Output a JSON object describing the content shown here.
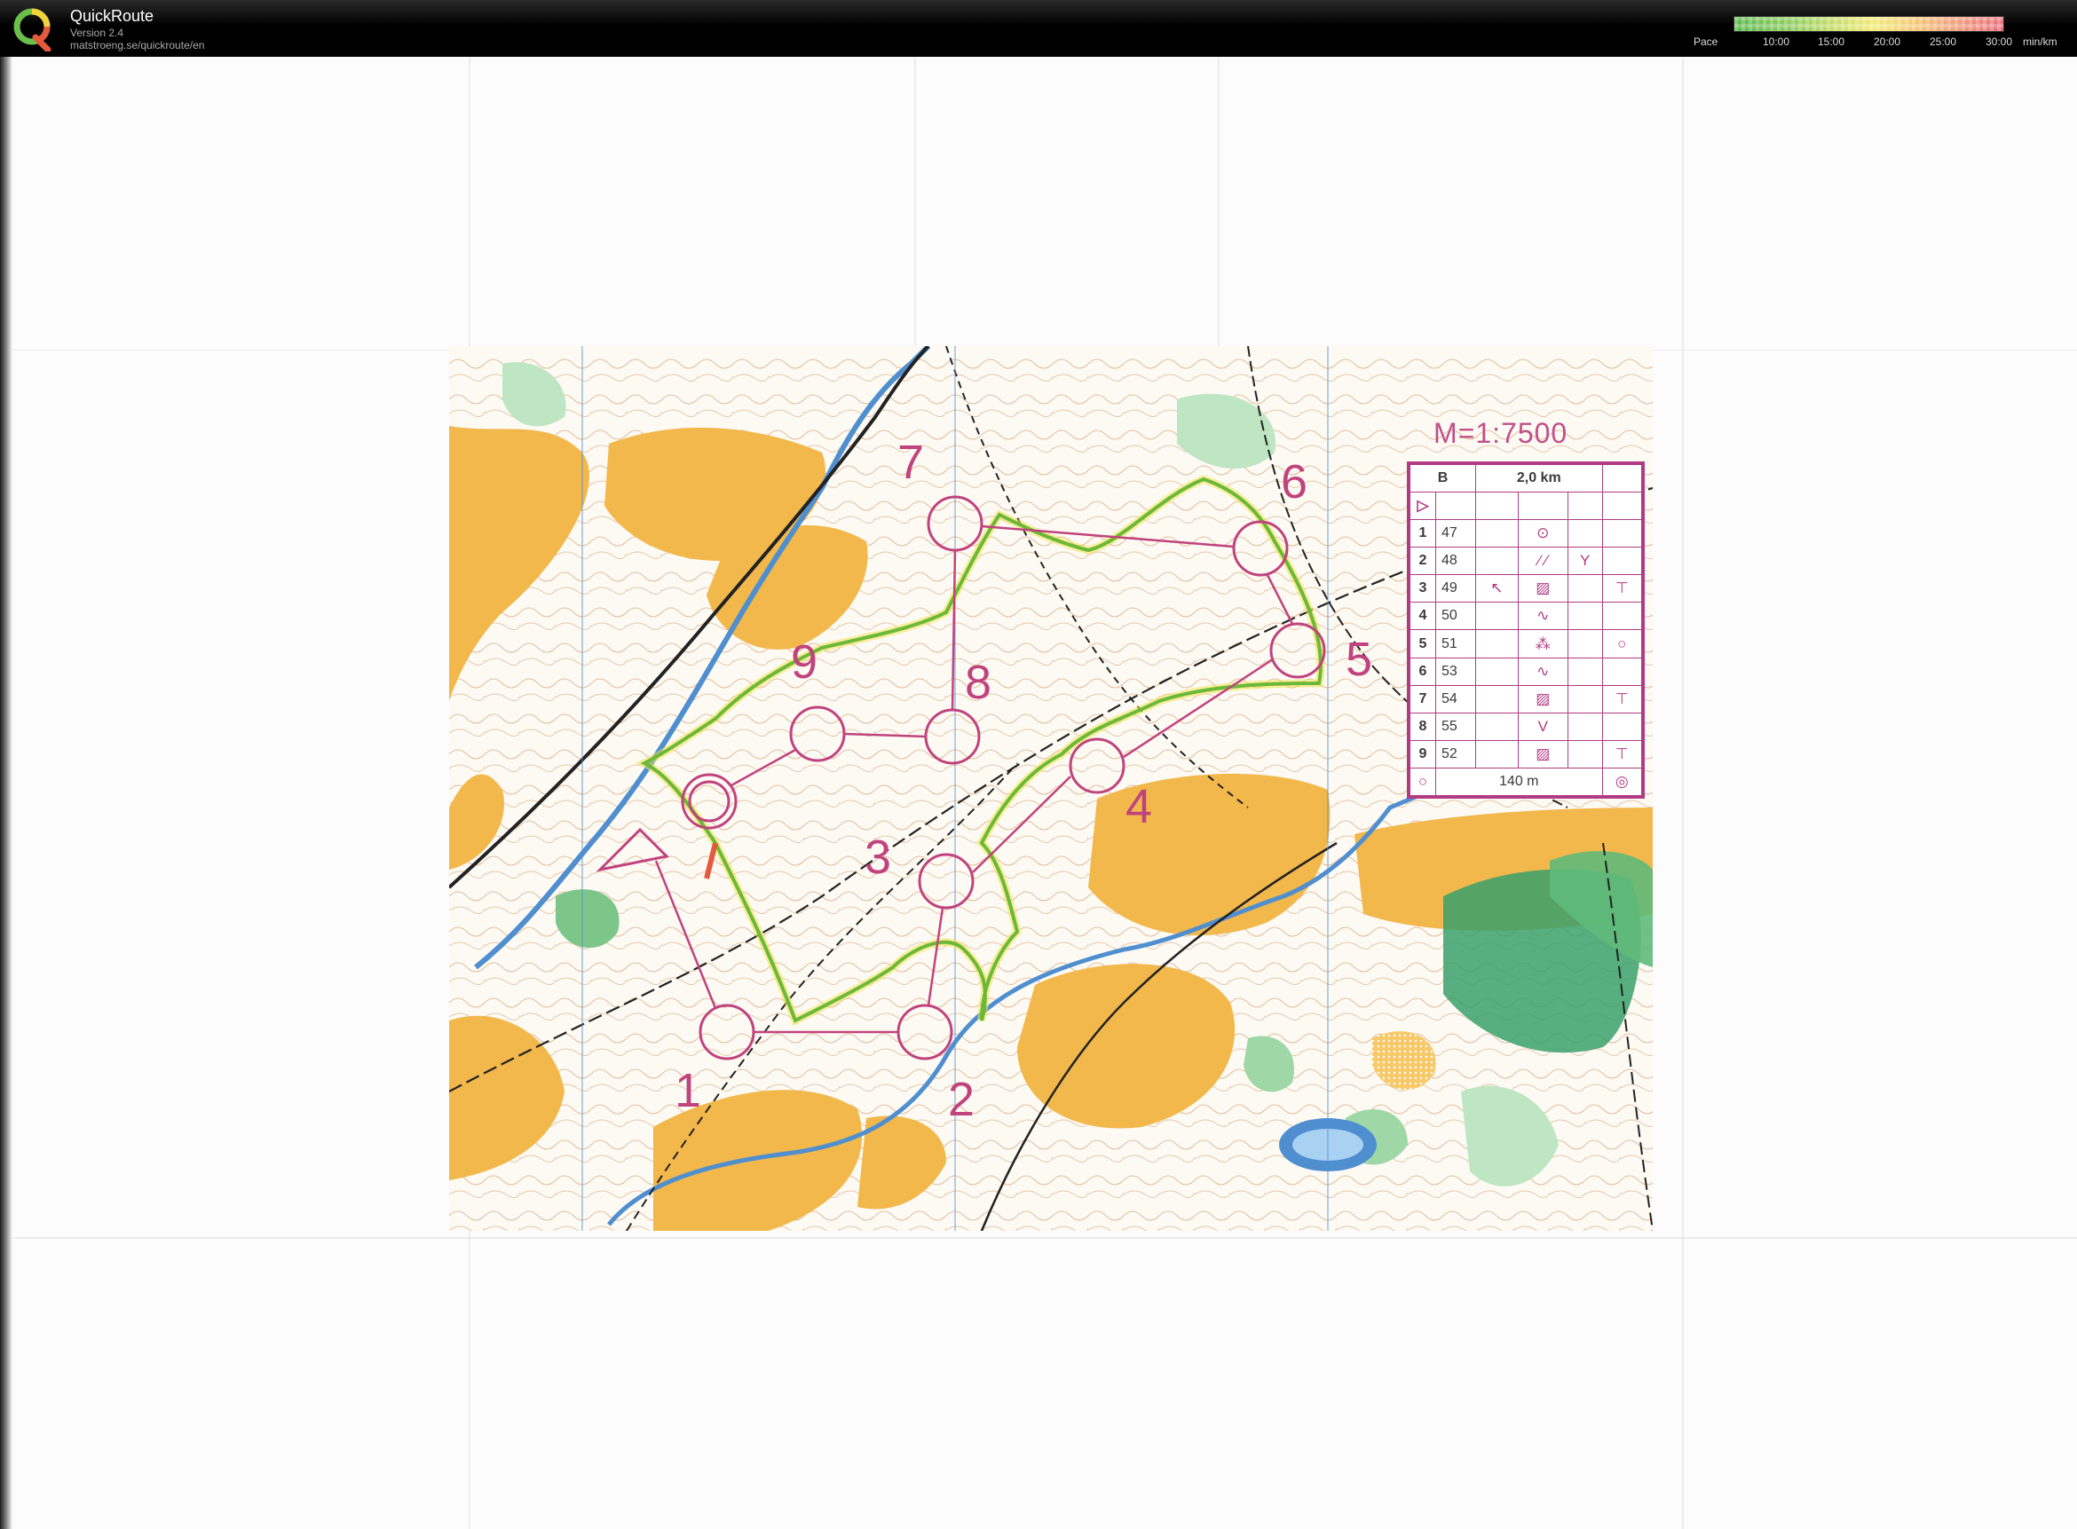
{
  "app": {
    "title": "QuickRoute",
    "version": "Version 2.4",
    "url": "matstroeng.se/quickroute/en"
  },
  "pace_legend": {
    "label": "Pace",
    "ticks": [
      "10:00",
      "15:00",
      "20:00",
      "25:00",
      "30:00"
    ],
    "unit": "min/km",
    "colors": [
      "#5fba52",
      "#c9de6b",
      "#f3eb78",
      "#f09a7e",
      "#e8707c"
    ]
  },
  "map": {
    "scale": "M=1:7500",
    "control_numbers": [
      "1",
      "2",
      "3",
      "4",
      "5",
      "6",
      "7",
      "8",
      "9"
    ],
    "colors": {
      "course": "#c0437e",
      "open_land": "#f2b84b",
      "forest_green": "#3aa06a",
      "water": "#4f8fd0",
      "route": "#9fcc3a"
    }
  },
  "description_sheet": {
    "class": "B",
    "length": "2,0 km",
    "controls": [
      {
        "num": "1",
        "code": "47",
        "s1": "",
        "s2": "⊙",
        "s3": "",
        "s4": ""
      },
      {
        "num": "2",
        "code": "48",
        "s1": "",
        "s2": "⁄ ⁄",
        "s3": "Y",
        "s4": ""
      },
      {
        "num": "3",
        "code": "49",
        "s1": "↖",
        "s2": "▨",
        "s3": "",
        "s4": "⊤"
      },
      {
        "num": "4",
        "code": "50",
        "s1": "",
        "s2": "∿",
        "s3": "",
        "s4": ""
      },
      {
        "num": "5",
        "code": "51",
        "s1": "",
        "s2": "⁂",
        "s3": "",
        "s4": "○"
      },
      {
        "num": "6",
        "code": "53",
        "s1": "",
        "s2": "∿",
        "s3": "",
        "s4": ""
      },
      {
        "num": "7",
        "code": "54",
        "s1": "",
        "s2": "▨",
        "s3": "",
        "s4": "⊤"
      },
      {
        "num": "8",
        "code": "55",
        "s1": "",
        "s2": "V",
        "s3": "",
        "s4": ""
      },
      {
        "num": "9",
        "code": "52",
        "s1": "",
        "s2": "▨",
        "s3": "",
        "s4": "⊤"
      }
    ],
    "finish_distance": "140 m"
  }
}
